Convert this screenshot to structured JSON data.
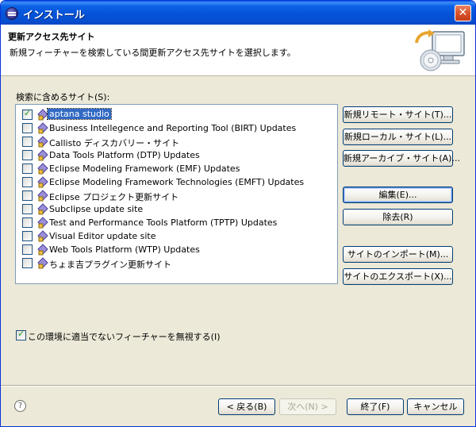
{
  "window": {
    "title": "インストール"
  },
  "banner": {
    "title": "更新アクセス先サイト",
    "description": "新規フィーチャーを検索している間更新アクセス先サイトを選択します。",
    "icon": "install-wizard-icon"
  },
  "sites": {
    "label": "検索に含めるサイト(S):",
    "items": [
      {
        "name": "aptana studio",
        "checked": true,
        "selected": true
      },
      {
        "name": "Business Intellegence and Reporting Tool (BIRT) Updates",
        "checked": false
      },
      {
        "name": "Callisto ディスカバリー・サイト",
        "checked": false
      },
      {
        "name": "Data Tools Platform (DTP) Updates",
        "checked": false
      },
      {
        "name": "Eclipse Modeling Framework (EMF) Updates",
        "checked": false
      },
      {
        "name": "Eclipse Modeling Framework Technologies (EMFT) Updates",
        "checked": false
      },
      {
        "name": "Eclipse プロジェクト更新サイト",
        "checked": false
      },
      {
        "name": "Subclipse update site",
        "checked": false
      },
      {
        "name": "Test and Performance Tools Platform (TPTP) Updates",
        "checked": false
      },
      {
        "name": "Visual Editor update site",
        "checked": false
      },
      {
        "name": "Web Tools Platform (WTP) Updates",
        "checked": false
      },
      {
        "name": "ちょま吉プラグイン更新サイト",
        "checked": false
      }
    ]
  },
  "side_buttons": {
    "new_remote": "新規リモート・サイト(T)...",
    "new_local": "新規ローカル・サイト(L)...",
    "new_archive": "新規アーカイブ・サイト(A)...",
    "edit": "編集(E)...",
    "remove": "除去(R)",
    "import": "サイトのインポート(M)...",
    "export": "サイトのエクスポート(X)..."
  },
  "option": {
    "label": "この環境に適当でないフィーチャーを無視する(I)",
    "checked": true
  },
  "footer": {
    "back": "< 戻る(B)",
    "next": "次へ(N) >",
    "finish": "終了(F)",
    "cancel": "キャンセル"
  }
}
